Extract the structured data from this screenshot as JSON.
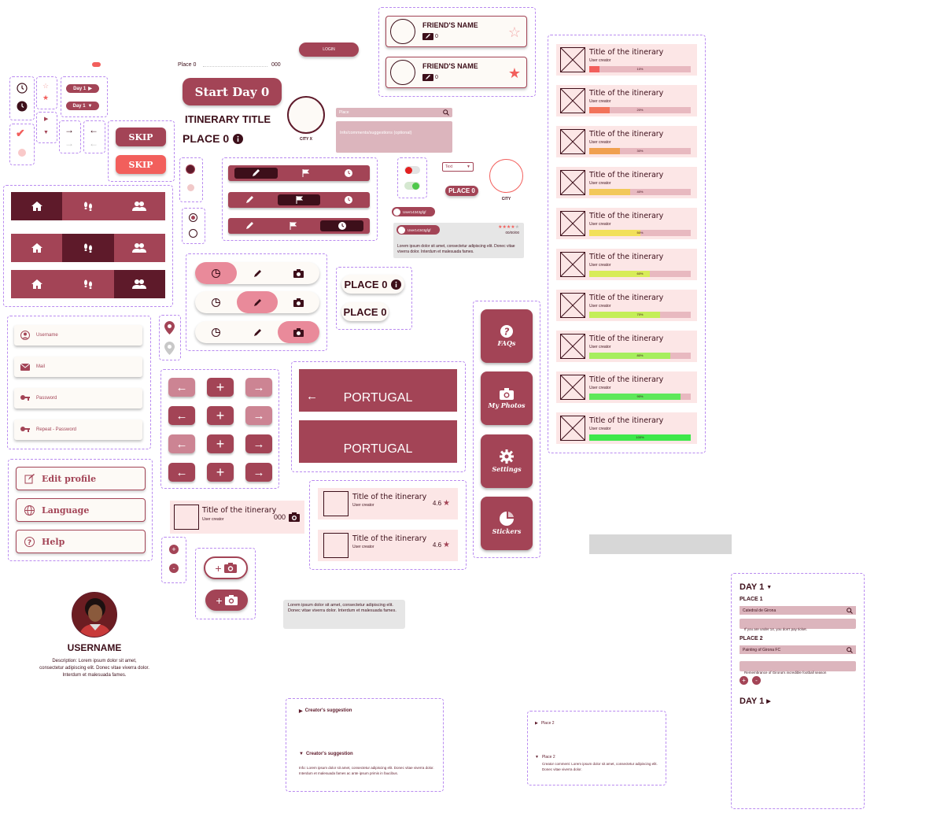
{
  "colors": {
    "primary": "#a34456",
    "dark": "#5e1a2a",
    "accent": "#f25f5c",
    "light": "#fce6e6",
    "rose": "#cc8493"
  },
  "header": {
    "place_label": "Place 0",
    "place_count": "000",
    "login_label": "LOGIN"
  },
  "dropdowns": {
    "day_a": "Day 1",
    "day_b": "Day 1"
  },
  "skip": {
    "label_1": "SKIP",
    "label_2": "SKIP"
  },
  "start": {
    "label": "Start Day 0",
    "itinerary_title": "ITINERARY TITLE",
    "place": "PLACE 0"
  },
  "city": {
    "city_x": "CITY X",
    "city": "CITY"
  },
  "form": {
    "place_placeholder": "Place",
    "info_placeholder": "Info/comments/suggestions (optional)"
  },
  "misc": {
    "text_select": "Text",
    "place_chip": "PLACE 0"
  },
  "user_chip": {
    "user_a": "User14343gfgf",
    "user_b": "User14343gfgf",
    "date": "00/00/00",
    "rating": 4,
    "comment": "Lorem ipsum dolor sit amet, consectetur adipiscing elit. Donec vitae viverra dolor. Interdum et malesuada fames."
  },
  "friends": [
    {
      "name": "FRIEND'S NAME",
      "count": "0",
      "favorite": false
    },
    {
      "name": "FRIEND'S NAME",
      "count": "0",
      "favorite": true
    }
  ],
  "places_tags": {
    "tag_1": "PLACE 0",
    "tag_2": "PLACE 0"
  },
  "login_form": {
    "username": "Username",
    "mail": "Mail",
    "password": "Password",
    "repeat": "Repeat - Password"
  },
  "profile_menu": {
    "edit": "Edit profile",
    "language": "Language",
    "help": "Help"
  },
  "country": {
    "country_1": "PORTUGAL",
    "country_2": "PORTUGAL"
  },
  "itinerary_small": {
    "title": "Title of the itinerary",
    "user": "User creator",
    "count": "000"
  },
  "rated_list": [
    {
      "title": "Title of the itinerary",
      "user": "User creator",
      "rating": "4.6"
    },
    {
      "title": "Title of the itinerary",
      "user": "User creator",
      "rating": "4.6"
    }
  ],
  "side_buttons": {
    "faqs": "FAQs",
    "photos": "My Photos",
    "settings": "Settings",
    "stickers": "Stickers"
  },
  "itineraries": [
    {
      "title": "Title of the itinerary",
      "user": "User creator",
      "progress": 10,
      "label": "10%",
      "color": "#f25f5c"
    },
    {
      "title": "Title of the itinerary",
      "user": "User creator",
      "progress": 20,
      "label": "20%",
      "color": "#f2735a"
    },
    {
      "title": "Title of the itinerary",
      "user": "User creator",
      "progress": 30,
      "label": "30%",
      "color": "#f0a050"
    },
    {
      "title": "Title of the itinerary",
      "user": "User creator",
      "progress": 40,
      "label": "40%",
      "color": "#f2c85a"
    },
    {
      "title": "Title of the itinerary",
      "user": "User creator",
      "progress": 50,
      "label": "50%",
      "color": "#f2e05a"
    },
    {
      "title": "Title of the itinerary",
      "user": "User creator",
      "progress": 60,
      "label": "60%",
      "color": "#d8ec58"
    },
    {
      "title": "Title of the itinerary",
      "user": "User creator",
      "progress": 70,
      "label": "70%",
      "color": "#c4ee58"
    },
    {
      "title": "Title of the itinerary",
      "user": "User creator",
      "progress": 80,
      "label": "80%",
      "color": "#a6ee5e"
    },
    {
      "title": "Title of the itinerary",
      "user": "User creator",
      "progress": 90,
      "label": "90%",
      "color": "#5ee85a"
    },
    {
      "title": "Title of the itinerary",
      "user": "User creator",
      "progress": 100,
      "label": "100%",
      "color": "#3ee84a"
    }
  ],
  "lorem": {
    "text": "Lorem ipsum dolor sit amet, consectetur adipiscing elit. Donec vitae viverra dolor. Interdum et malesuada fames."
  },
  "profile": {
    "username": "USERNAME",
    "description": "Description: Lorem ipsum dolor sit amet, consectetur adipiscing elit. Donec vitae viverra dolor. Interdum et malesuada fames."
  },
  "creator": {
    "collapsed": "Creator's suggestion",
    "expanded": "Creator's suggestion",
    "info": "Info: Lorem ipsum dolor sit amet, consectetur adipiscing elit. Donec vitae viverra dolor. Interdum et malesuada fames ac ante ipsum primis in faucibus."
  },
  "place2": {
    "collapsed": "Place 2",
    "expanded": "Place 2",
    "comment": "Creator comment: Lorem ipsum dolor sit amet, consectetur adipiscing elit. Donec vitae viverra dolor."
  },
  "day_panel": {
    "day": "DAY 1",
    "place1": "PLACE 1",
    "place1_value": "Catedral de Girona",
    "place1_note": "If you are under 14, you don't pay ticket.",
    "place2": "PLACE 2",
    "place2_value": "Painting of Girona FC",
    "place2_note": "Remembrance of Girona's incredible football season",
    "day_collapsed": "DAY 1"
  }
}
